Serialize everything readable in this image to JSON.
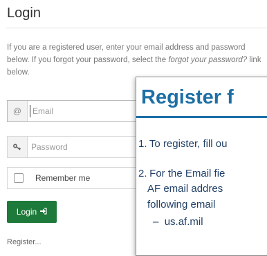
{
  "login": {
    "title": "Login",
    "intro_part1": "If you are a registered user, enter your email address and password below. If you forgot your password, select the ",
    "intro_link": "forgot your password?",
    "intro_part2": " link below.",
    "email_placeholder": "Email",
    "password_placeholder": "Password",
    "remember_label": "Remember me",
    "login_button": "Login",
    "register_link": "Register..."
  },
  "icons": {
    "email_addon": "@",
    "password_addon": "key-icon",
    "login_button_icon": "sign-in-icon"
  },
  "overlay": {
    "title": "Register f",
    "item1": "To register, fill ou",
    "item2_line1": "For the Email fie",
    "item2_line2": "AF email addres",
    "item2_line3": "following email",
    "sub_item": "us.af.mil",
    "num1": "1.",
    "num2": "2.",
    "dash": "–"
  },
  "colors": {
    "login_button": "#1e7a3a",
    "overlay_title": "#1d6fa5",
    "overlay_text": "#1f3f66"
  }
}
